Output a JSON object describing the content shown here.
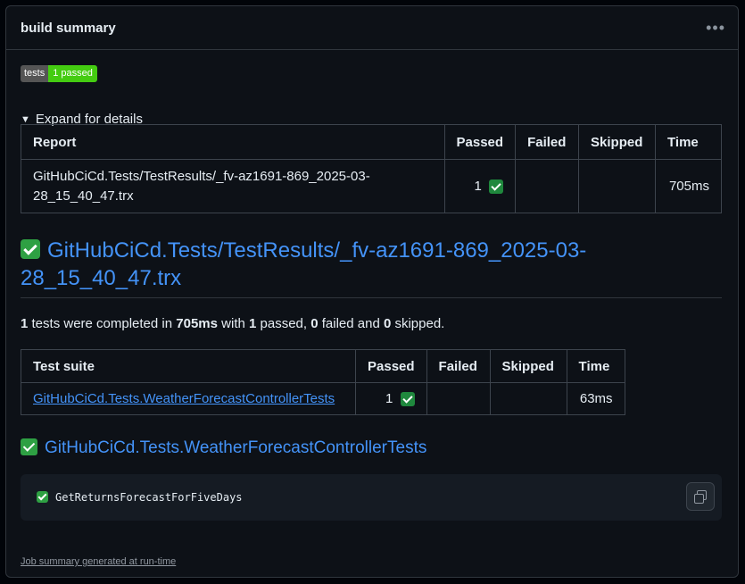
{
  "card": {
    "title": "build summary",
    "menu_icon": "kebab-horizontal-icon"
  },
  "badge": {
    "label": "tests",
    "value": "1 passed",
    "label_color": "#555555",
    "value_color": "#44cc11"
  },
  "details": {
    "summary": "Expand for details"
  },
  "report_table": {
    "headers": [
      "Report",
      "Passed",
      "Failed",
      "Skipped",
      "Time"
    ],
    "rows": [
      {
        "report": "GitHubCiCd.Tests/TestResults/_fv-az1691-869_2025-03-28_15_40_47.trx",
        "passed": "1",
        "failed": "",
        "skipped": "",
        "time": "705ms"
      }
    ]
  },
  "result_heading": "GitHubCiCd.Tests/TestResults/_fv-az1691-869_2025-03-28_15_40_47.trx",
  "summary": {
    "tests": "1",
    "t1": " tests were completed in ",
    "duration": "705ms",
    "t2": " with ",
    "passed": "1",
    "t3": " passed, ",
    "failed": "0",
    "t4": " failed and ",
    "skipped": "0",
    "t5": " skipped."
  },
  "suite_table": {
    "headers": [
      "Test suite",
      "Passed",
      "Failed",
      "Skipped",
      "Time"
    ],
    "rows": [
      {
        "suite": "GitHubCiCd.Tests.WeatherForecastControllerTests",
        "passed": "1",
        "failed": "",
        "skipped": "",
        "time": "63ms"
      }
    ]
  },
  "suite_heading": "GitHubCiCd.Tests.WeatherForecastControllerTests",
  "test_case": {
    "name": "GetReturnsForecastForFiveDays",
    "status": "passed"
  },
  "copy_icon": "copy-icon",
  "footer": "Job summary generated at run-time",
  "colors": {
    "link": "#4493f8",
    "pass": "#2ea043",
    "background": "#0d1117",
    "border": "#30363d"
  }
}
